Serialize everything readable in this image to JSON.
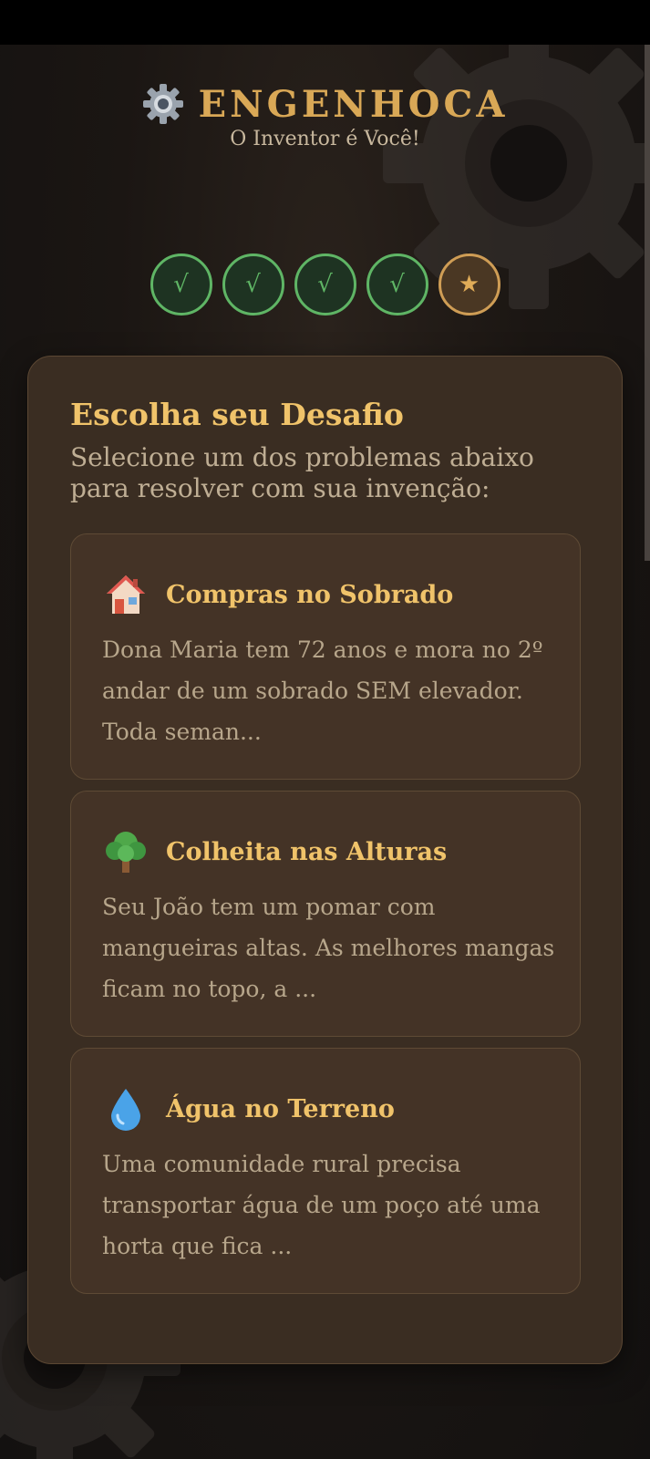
{
  "app": {
    "title": "ENGENHOCA",
    "subtitle": "O Inventor é Você!",
    "logo_icon": "gear-icon"
  },
  "progress": {
    "steps": [
      {
        "symbol": "√",
        "state": "done"
      },
      {
        "symbol": "√",
        "state": "done"
      },
      {
        "symbol": "√",
        "state": "done"
      },
      {
        "symbol": "√",
        "state": "done"
      },
      {
        "symbol": "★",
        "state": "current"
      }
    ]
  },
  "main": {
    "heading": "Escolha seu Desafio",
    "description": "Selecione um dos problemas abaixo para resolver com sua invenção:",
    "challenges": [
      {
        "icon": "house-icon",
        "title": "Compras no Sobrado",
        "text": "Dona Maria tem 72 anos e mora no 2º andar de um sobrado SEM elevador. Toda seman..."
      },
      {
        "icon": "tree-icon",
        "title": "Colheita nas Alturas",
        "text": "Seu João tem um pomar com mangueiras altas. As melhores mangas ficam no topo, a ..."
      },
      {
        "icon": "water-drop-icon",
        "title": "Água no Terreno",
        "text": "Uma comunidade rural precisa transportar água de um poço até uma horta que fica ..."
      }
    ]
  },
  "colors": {
    "accent": "#d9a856",
    "done": "#5fb565",
    "card_bg": "#3a2d22",
    "page_bg": "#14110f"
  }
}
